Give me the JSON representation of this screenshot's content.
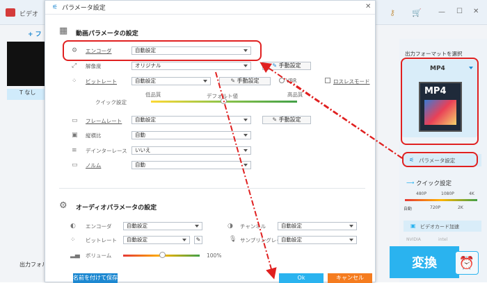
{
  "main": {
    "title": "ビデオ",
    "add_label": "+ フ",
    "subtitle_label": "T なし",
    "output_folder_label": "出力フォル",
    "convert_label": "変換",
    "output_format_label": "出力フォーマットを選択",
    "format_name": "MP4",
    "format_icon_text": "MP4",
    "param_button_label": "パラメータ設定",
    "quick_settings_label": "クイック設定",
    "quality_marks_top": [
      "480P",
      "1080P",
      "4K"
    ],
    "quality_marks_bottom": [
      "自動",
      "720P",
      "2K"
    ],
    "gpu_label": "ビデオカード加速",
    "gpu_brands": [
      "NVIDIA",
      "intel"
    ]
  },
  "dialog": {
    "title": "パラメータ設定",
    "video_section": "動画パラメータの設定",
    "encoder_label": "エンコーダ",
    "encoder_value": "自動設定",
    "resolution_label": "解像度",
    "resolution_value": "オリジナル",
    "manual_label": "手動設定",
    "bitrate_label": "ビットレート",
    "bitrate_value": "自動設定",
    "vbr_label": "VBR",
    "lossless_label": "ロスレスモード",
    "quick_setting_label": "クイック設定",
    "quality_low": "低品質",
    "quality_default": "デフォルト値",
    "quality_high": "高品質",
    "framerate_label": "フレームレート",
    "framerate_value": "自動設定",
    "aspect_label": "縦横比",
    "aspect_value": "自動",
    "deinterlace_label": "デインターレース",
    "deinterlace_value": "いいえ",
    "norm_label": "ノルム",
    "norm_value": "自動",
    "audio_section": "オーディオパラメータの設定",
    "a_encoder_label": "エンコーダ",
    "a_encoder_value": "自動設定",
    "channel_label": "チャンネル",
    "channel_value": "自動設定",
    "a_bitrate_label": "ビットレート",
    "a_bitrate_value": "自動設定",
    "sample_label": "サンプリングレート",
    "sample_value": "自動設定",
    "volume_label": "ボリューム",
    "volume_value": "100%",
    "save_as_label": "名前を付けて保存",
    "ok_label": "Ok",
    "cancel_label": "キャンセル"
  },
  "colors": {
    "accent": "#2ab3ef",
    "highlight": "#e02020",
    "cancel": "#f57c1f"
  }
}
